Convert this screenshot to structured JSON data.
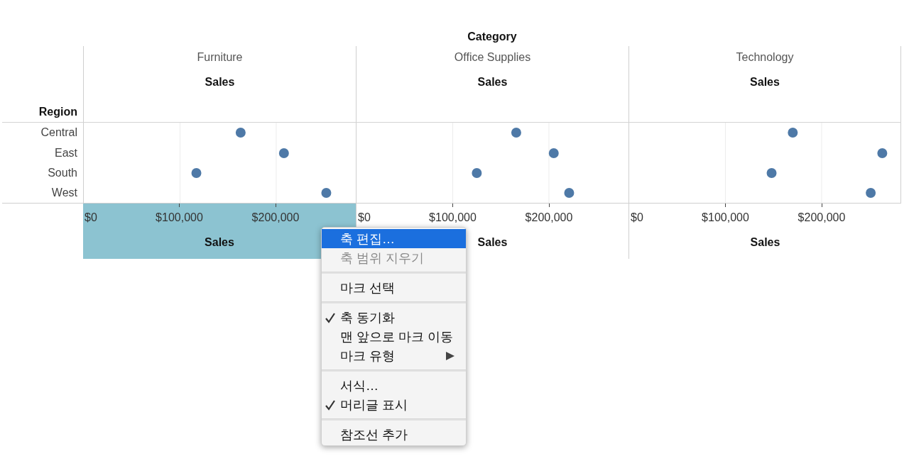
{
  "column_header": "Category",
  "row_header": "Region",
  "panes": [
    {
      "category": "Furniture",
      "axis_selected": true,
      "chart_data": {
        "type": "scatter",
        "orientation": "horizontal",
        "categories": [
          "Central",
          "East",
          "South",
          "West"
        ],
        "xlabel": "Sales",
        "xlim": [
          0,
          283400
        ],
        "xticks": [
          {
            "value": 0,
            "label": "$0"
          },
          {
            "value": 100000,
            "label": "$100,000"
          },
          {
            "value": 200000,
            "label": "$200,000"
          }
        ],
        "series": [
          {
            "name": "Sales",
            "color": "#4e79a7",
            "values": [
              163000,
              208000,
              117000,
              252000
            ]
          }
        ]
      }
    },
    {
      "category": "Office Supplies",
      "axis_selected": false,
      "chart_data": {
        "type": "scatter",
        "orientation": "horizontal",
        "xlabel": "Sales",
        "xlim": [
          0,
          283400
        ],
        "xticks": [
          {
            "value": 0,
            "label": "$0"
          },
          {
            "value": 100000,
            "label": "$100,000"
          },
          {
            "value": 200000,
            "label": "$200,000"
          }
        ],
        "series": [
          {
            "name": "Sales",
            "color": "#4e79a7",
            "values": [
              166000,
              205000,
              125000,
              221000
            ]
          }
        ]
      }
    },
    {
      "category": "Technology",
      "axis_selected": false,
      "chart_data": {
        "type": "scatter",
        "orientation": "horizontal",
        "xlabel": "Sales",
        "xlim": [
          0,
          283400
        ],
        "xticks": [
          {
            "value": 0,
            "label": "$0"
          },
          {
            "value": 100000,
            "label": "$100,000"
          },
          {
            "value": 200000,
            "label": "$200,000"
          }
        ],
        "series": [
          {
            "name": "Sales",
            "color": "#4e79a7",
            "values": [
              170000,
              263000,
              148000,
              251000
            ]
          }
        ]
      }
    }
  ],
  "context_menu": {
    "groups": [
      [
        {
          "label": "축 편집…",
          "selected": true,
          "disabled": false,
          "checked": false,
          "submenu": false
        },
        {
          "label": "축 범위 지우기",
          "selected": false,
          "disabled": true,
          "checked": false,
          "submenu": false
        }
      ],
      [
        {
          "label": "마크 선택",
          "selected": false,
          "disabled": false,
          "checked": false,
          "submenu": false
        }
      ],
      [
        {
          "label": "축 동기화",
          "selected": false,
          "disabled": false,
          "checked": true,
          "submenu": false
        },
        {
          "label": "맨 앞으로 마크 이동",
          "selected": false,
          "disabled": false,
          "checked": false,
          "submenu": false
        },
        {
          "label": "마크 유형",
          "selected": false,
          "disabled": false,
          "checked": false,
          "submenu": true
        }
      ],
      [
        {
          "label": "서식…",
          "selected": false,
          "disabled": false,
          "checked": false,
          "submenu": false
        },
        {
          "label": "머리글 표시",
          "selected": false,
          "disabled": false,
          "checked": true,
          "submenu": false
        }
      ],
      [
        {
          "label": "참조선 추가",
          "selected": false,
          "disabled": false,
          "checked": false,
          "submenu": false
        }
      ]
    ]
  }
}
